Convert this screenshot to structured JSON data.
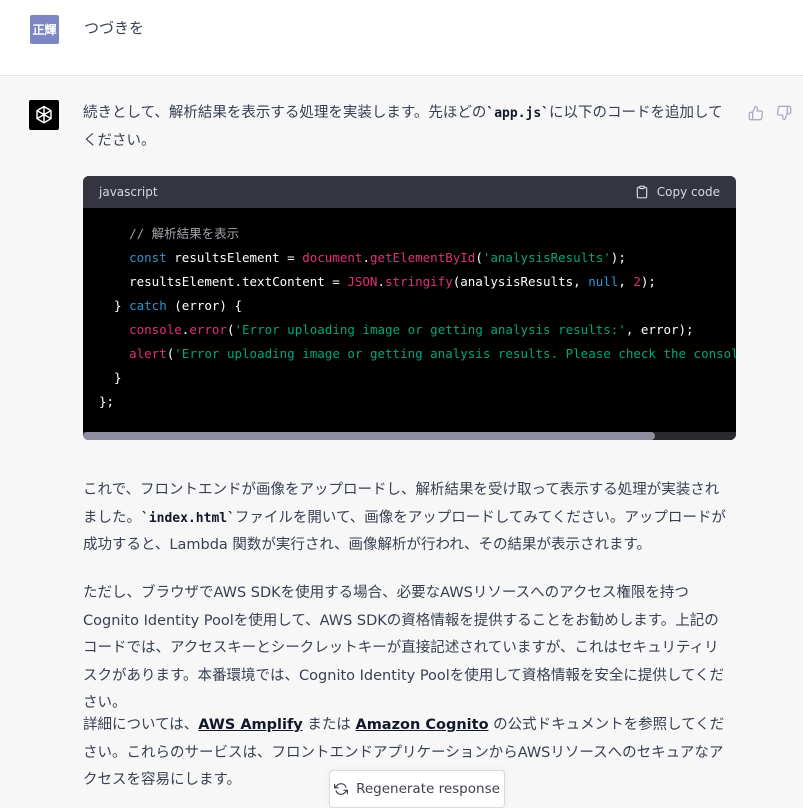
{
  "user": {
    "avatar_text": "正輝",
    "message": "つづきを"
  },
  "assistant": {
    "intro_before": "続きとして、解析結果を表示する処理を実装します。先ほどの",
    "intro_code": "`app.js`",
    "intro_after": "に以下のコードを追加してください。",
    "code": {
      "language": "javascript",
      "copy_label": "Copy code"
    },
    "para2_line1": "これで、フロントエンドが画像をアップロードし、解析結果を受け取って表示する処理が実装されました。",
    "para2_code": "`index.html`",
    "para2_rest": "ファイルを開いて、画像をアップロードしてみてください。アップロードが成功すると、Lambda 関数が実行され、画像解析が行われ、その結果が表示されます。",
    "para3": "ただし、ブラウザでAWS SDKを使用する場合、必要なAWSリソースへのアクセス権限を持つCognito Identity Poolを使用して、AWS SDKの資格情報を提供することをお勧めします。上記のコードでは、アクセスキーとシークレットキーが直接記述されていますが、これはセキュリティリスクがあります。本番環境では、Cognito Identity Poolを使用して資格情報を安全に提供してください。",
    "para4_before": "詳細については、",
    "link_amplify": "AWS Amplify",
    "para4_mid": " または ",
    "link_cognito": "Amazon Cognito",
    "para4_after": " の公式ドキュメントを参照してください。これらのサービスは、フロントエンドアプリケーションからAWSリソースへのセキュアなアクセスを容易にします。"
  },
  "regenerate_label": "Regenerate response",
  "icons": {
    "bot_avatar": "openai-logo-icon",
    "thumb_up": "thumbs-up-icon",
    "thumb_down": "thumbs-down-icon",
    "copy": "clipboard-icon",
    "regenerate": "refresh-icon"
  },
  "colors": {
    "user_avatar_bg": "#7b86c3",
    "assistant_bg": "#f7f7f8",
    "code_bg": "#000000",
    "code_header_bg": "#343541"
  }
}
